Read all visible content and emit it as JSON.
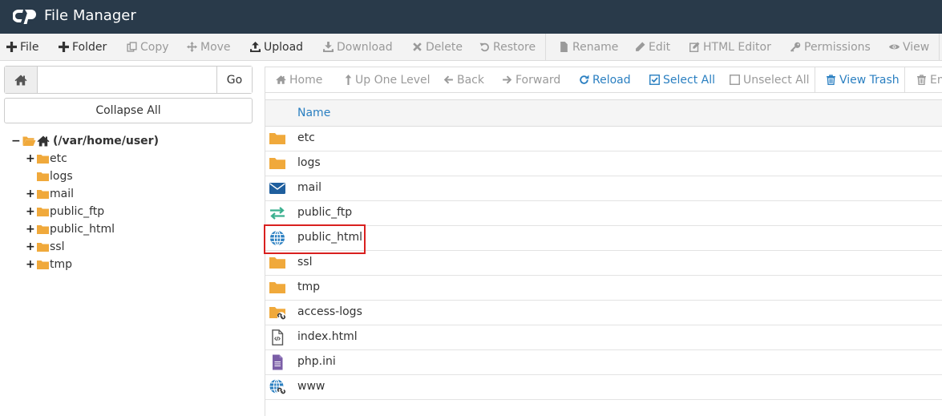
{
  "app": {
    "title": "File Manager"
  },
  "toolbar": {
    "items": [
      {
        "label": "File",
        "icon": "plus-icon"
      },
      {
        "label": "Folder",
        "icon": "plus-icon"
      },
      {
        "label": "Copy",
        "icon": "copy-icon"
      },
      {
        "label": "Move",
        "icon": "move-icon"
      },
      {
        "label": "Upload",
        "icon": "upload-icon"
      },
      {
        "label": "Download",
        "icon": "download-icon"
      },
      {
        "label": "Delete",
        "icon": "times-icon"
      },
      {
        "label": "Restore",
        "icon": "undo-icon"
      },
      {
        "label": "Rename",
        "icon": "file-icon"
      },
      {
        "label": "Edit",
        "icon": "pencil-icon"
      },
      {
        "label": "HTML Editor",
        "icon": "edit-icon"
      },
      {
        "label": "Permissions",
        "icon": "key-icon"
      },
      {
        "label": "View",
        "icon": "eye-icon"
      }
    ]
  },
  "sidebar": {
    "path_value": "",
    "go_label": "Go",
    "collapse_label": "Collapse All",
    "root_label": "(/var/home/user)",
    "tree": [
      {
        "label": "etc",
        "expandable": true
      },
      {
        "label": "logs",
        "expandable": false
      },
      {
        "label": "mail",
        "expandable": true
      },
      {
        "label": "public_ftp",
        "expandable": true
      },
      {
        "label": "public_html",
        "expandable": true
      },
      {
        "label": "ssl",
        "expandable": true
      },
      {
        "label": "tmp",
        "expandable": true
      }
    ]
  },
  "actionbar": {
    "items": [
      {
        "label": "Home",
        "icon": "home-icon"
      },
      {
        "label": "Up One Level",
        "icon": "level-up-icon"
      },
      {
        "label": "Back",
        "icon": "arrow-left-icon"
      },
      {
        "label": "Forward",
        "icon": "arrow-right-icon"
      },
      {
        "label": "Reload",
        "icon": "refresh-icon"
      },
      {
        "label": "Select All",
        "icon": "checkbox-checked-icon"
      },
      {
        "label": "Unselect All",
        "icon": "checkbox-empty-icon"
      },
      {
        "label": "View Trash",
        "icon": "trash-icon"
      },
      {
        "label": "Em",
        "icon": "trash-icon"
      }
    ]
  },
  "table": {
    "header_name": "Name",
    "rows": [
      {
        "name": "etc",
        "icon": "folder-icon"
      },
      {
        "name": "logs",
        "icon": "folder-icon"
      },
      {
        "name": "mail",
        "icon": "envelope-icon"
      },
      {
        "name": "public_ftp",
        "icon": "transfer-arrows-icon"
      },
      {
        "name": "public_html",
        "icon": "globe-icon"
      },
      {
        "name": "ssl",
        "icon": "folder-icon"
      },
      {
        "name": "tmp",
        "icon": "folder-icon"
      },
      {
        "name": "access-logs",
        "icon": "folder-link-icon"
      },
      {
        "name": "index.html",
        "icon": "html-file-icon"
      },
      {
        "name": "php.ini",
        "icon": "text-file-icon"
      },
      {
        "name": "www",
        "icon": "globe-link-icon"
      }
    ]
  },
  "colors": {
    "titlebar": "#293a4a",
    "folder": "#f0a93b",
    "accent_blue": "#2a7fc1",
    "mail_blue": "#1f5f9e",
    "ftp_green": "#3bb08f",
    "file_purple": "#7b5ea7",
    "highlight_red": "#d9201f"
  }
}
